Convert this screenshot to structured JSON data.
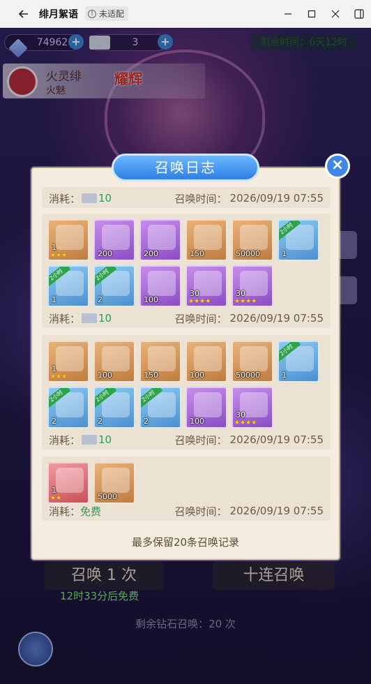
{
  "window": {
    "title": "绯月絮语",
    "badge": "未适配"
  },
  "hud": {
    "diamonds": "74962",
    "tickets": "3",
    "remaining_time": "剩余时间：6天12时"
  },
  "character": {
    "name": "火灵绯",
    "subtitle": "火魅",
    "tag": "耀辉"
  },
  "background": {
    "summon_once": "召唤 1 次",
    "summon_ten": "十连召唤",
    "free_after": "12时33分后免费",
    "diamond_remaining": "剩余钻石召唤：20 次"
  },
  "modal": {
    "title": "召唤日志",
    "footer": "最多保留20条召唤记录",
    "records": [
      {
        "cost_label": "消耗：",
        "cost_value": "10",
        "time_label": "召唤时间：",
        "time_value": "2026/09/19 07:55",
        "items": []
      },
      {
        "cost_label": "消耗：",
        "cost_value": "10",
        "time_label": "召唤时间：",
        "time_value": "2026/09/19 07:55",
        "items": [
          {
            "color": "orange",
            "count": "1",
            "stars": "★★★",
            "ribbon": ""
          },
          {
            "color": "purple",
            "count": "200",
            "stars": "",
            "ribbon": ""
          },
          {
            "color": "purple",
            "count": "200",
            "stars": "",
            "ribbon": ""
          },
          {
            "color": "orange",
            "count": "150",
            "stars": "",
            "ribbon": ""
          },
          {
            "color": "orange",
            "count": "50000",
            "stars": "",
            "ribbon": ""
          },
          {
            "color": "blue",
            "count": "1",
            "stars": "",
            "ribbon": "2小时"
          },
          {
            "color": "blue",
            "count": "1",
            "stars": "",
            "ribbon": "2小时"
          },
          {
            "color": "blue",
            "count": "2",
            "stars": "",
            "ribbon": "2小时"
          },
          {
            "color": "purple",
            "count": "100",
            "stars": "",
            "ribbon": ""
          },
          {
            "color": "purple",
            "count": "30",
            "stars": "★★★★",
            "ribbon": ""
          },
          {
            "color": "purple",
            "count": "30",
            "stars": "★★★★",
            "ribbon": ""
          }
        ]
      },
      {
        "cost_label": "消耗：",
        "cost_value": "10",
        "time_label": "召唤时间：",
        "time_value": "2026/09/19 07:55",
        "items": [
          {
            "color": "orange",
            "count": "1",
            "stars": "★★★",
            "ribbon": ""
          },
          {
            "color": "orange",
            "count": "100",
            "stars": "",
            "ribbon": ""
          },
          {
            "color": "orange",
            "count": "150",
            "stars": "",
            "ribbon": ""
          },
          {
            "color": "orange",
            "count": "100",
            "stars": "",
            "ribbon": ""
          },
          {
            "color": "orange",
            "count": "50000",
            "stars": "",
            "ribbon": ""
          },
          {
            "color": "blue",
            "count": "1",
            "stars": "",
            "ribbon": "2小时"
          },
          {
            "color": "blue",
            "count": "2",
            "stars": "",
            "ribbon": "2小时"
          },
          {
            "color": "blue",
            "count": "2",
            "stars": "",
            "ribbon": "2小时"
          },
          {
            "color": "blue",
            "count": "2",
            "stars": "",
            "ribbon": "2小时"
          },
          {
            "color": "purple",
            "count": "100",
            "stars": "",
            "ribbon": ""
          },
          {
            "color": "purple",
            "count": "30",
            "stars": "★★★★",
            "ribbon": ""
          }
        ]
      },
      {
        "cost_label": "消耗：",
        "cost_value": "免费",
        "time_label": "召唤时间：",
        "time_value": "2026/09/19 07:55",
        "items": [
          {
            "color": "red",
            "count": "1",
            "stars": "★★",
            "ribbon": ""
          },
          {
            "color": "orange",
            "count": "5000",
            "stars": "",
            "ribbon": ""
          }
        ]
      }
    ]
  }
}
